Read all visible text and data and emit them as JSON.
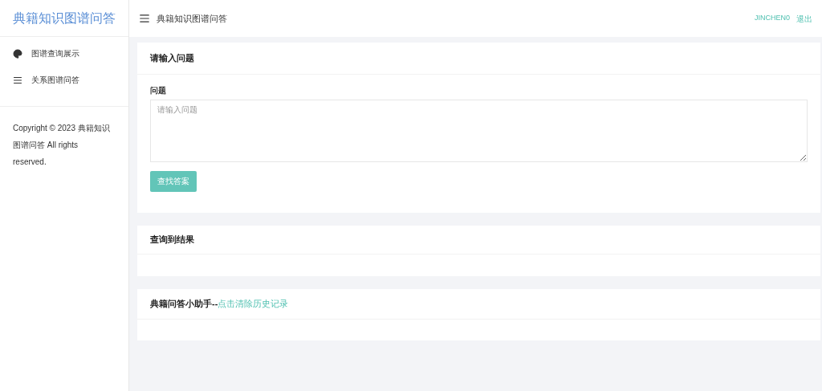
{
  "sidebar": {
    "logo": "典籍知识图谱问答",
    "items": [
      {
        "label": "图谱查询展示",
        "kind": "palette"
      },
      {
        "label": "关系图谱问答",
        "kind": "list"
      }
    ],
    "copyright": "Copyright © 2023 典籍知识图谱问答 All rights reserved."
  },
  "header": {
    "title": "典籍知识图谱问答",
    "user": "JINCHEN0",
    "logout": "退出"
  },
  "question_card": {
    "title": "请输入问题",
    "field_label": "问题",
    "placeholder": "请输入问题",
    "button": "查找答案"
  },
  "result_card": {
    "title": "查询到结果"
  },
  "history_card": {
    "title": "典籍问答小助手--",
    "link": "点击清除历史记录"
  }
}
